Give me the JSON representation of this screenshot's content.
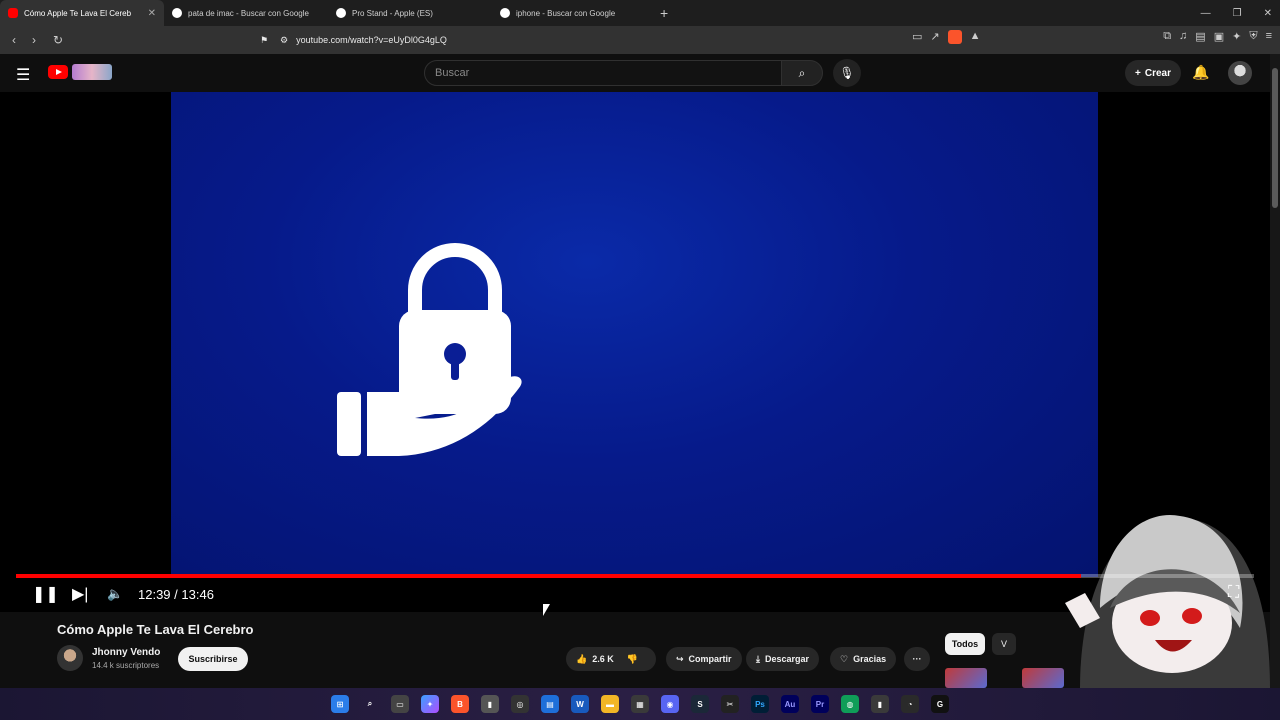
{
  "browser": {
    "tabs": [
      {
        "title": "Cómo Apple Te Lava El Cereb",
        "active": true
      },
      {
        "title": "pata de imac - Buscar con Google",
        "active": false
      },
      {
        "title": "Pro Stand - Apple (ES)",
        "active": false
      },
      {
        "title": "iphone - Buscar con Google",
        "active": false
      }
    ],
    "new_tab": "+",
    "url": "youtube.com/watch?v=eUyDl0G4gLQ"
  },
  "youtube": {
    "search_placeholder": "Buscar",
    "create_label": "Crear"
  },
  "player": {
    "time_current": "12:39",
    "time_separator": "/",
    "time_total": "13:46",
    "progress_fraction": 0.86
  },
  "video": {
    "title": "Cómo Apple Te Lava El Cerebro",
    "channel_name": "Jhonny Vendo",
    "subscribers": "14.4 k suscriptores",
    "subscribe_label": "Suscribirse",
    "likes": "2.6 K",
    "share_label": "Compartir",
    "download_label": "Descargar",
    "thanks_label": "Gracias",
    "more_label": "···"
  },
  "sidebar": {
    "chip_all": "Todos",
    "chip_next": "V"
  },
  "colors": {
    "youtube_red": "#ff0000",
    "video_blue": "#061a8a"
  }
}
